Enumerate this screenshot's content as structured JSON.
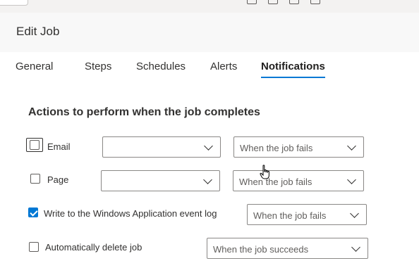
{
  "header": {
    "title": "Edit Job"
  },
  "tabs": [
    {
      "label": "General"
    },
    {
      "label": "Steps"
    },
    {
      "label": "Schedules"
    },
    {
      "label": "Alerts"
    },
    {
      "label": "Notifications"
    }
  ],
  "active_tab": "Notifications",
  "section": {
    "title": "Actions to perform when the job completes"
  },
  "rows": {
    "email": {
      "label": "Email",
      "checked": false,
      "operator_value": "",
      "condition_value": "When the job fails"
    },
    "page": {
      "label": "Page",
      "checked": false,
      "operator_value": "",
      "condition_value": "When the job fails"
    },
    "eventlog": {
      "label": "Write to the Windows Application event log",
      "checked": true,
      "condition_value": "When the job fails"
    },
    "delete": {
      "label": "Automatically delete job",
      "checked": false,
      "condition_value": "When the job succeeds"
    }
  },
  "colors": {
    "accent": "#0078d4",
    "header_bg": "#f8f8f8",
    "text": "#323130"
  },
  "icons": [
    "hand-pointer-icon",
    "chevron-down-icon"
  ]
}
